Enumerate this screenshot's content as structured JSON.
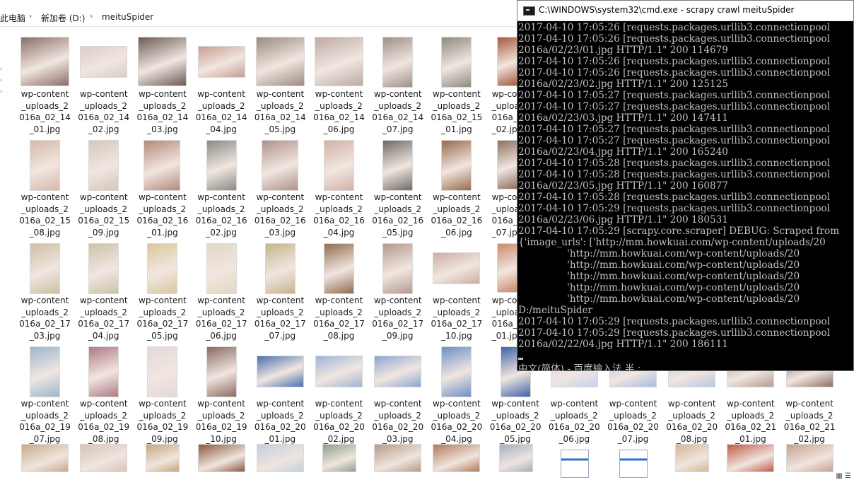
{
  "explorer": {
    "breadcrumb": [
      "此电脑",
      "新加卷 (D:)",
      "meituSpider"
    ],
    "files": [
      {
        "name": [
          "wp-content",
          "_uploads_2",
          "016a_02_14",
          "_01.jpg"
        ],
        "shape": "sq",
        "color": "#8a6f66"
      },
      {
        "name": [
          "wp-content",
          "_uploads_2",
          "016a_02_14",
          "_02.jpg"
        ],
        "shape": "land",
        "color": "#d9ccc7"
      },
      {
        "name": [
          "wp-content",
          "_uploads_2",
          "016a_02_14",
          "_03.jpg"
        ],
        "shape": "sq",
        "color": "#6e5a55"
      },
      {
        "name": [
          "wp-content",
          "_uploads_2",
          "016a_02_14",
          "_04.jpg"
        ],
        "shape": "land",
        "color": "#c79d92"
      },
      {
        "name": [
          "wp-content",
          "_uploads_2",
          "016a_02_14",
          "_05.jpg"
        ],
        "shape": "sq",
        "color": "#9c8a7f"
      },
      {
        "name": [
          "wp-content",
          "_uploads_2",
          "016a_02_14",
          "_06.jpg"
        ],
        "shape": "sq",
        "color": "#bdaaa3"
      },
      {
        "name": [
          "wp-content",
          "_uploads_2",
          "016a_02_14",
          "_07.jpg"
        ],
        "shape": "portn",
        "color": "#a08f88"
      },
      {
        "name": [
          "wp-content",
          "_uploads_2",
          "016a_02_15",
          "_01.jpg"
        ],
        "shape": "portn",
        "color": "#8f8a80"
      },
      {
        "name": [
          "wp-co",
          "_uploa",
          "016a_",
          "_02.jp"
        ],
        "shape": "part",
        "color": "#a35a3a"
      },
      {
        "name": [
          "wp-content",
          "_uploads_2",
          "016a_02_15",
          "_08.jpg"
        ],
        "shape": "portn",
        "color": "#d6b9a8"
      },
      {
        "name": [
          "wp-content",
          "_uploads_2",
          "016a_02_15",
          "_09.jpg"
        ],
        "shape": "portn",
        "color": "#d7c6b9"
      },
      {
        "name": [
          "wp-content",
          "_uploads_2",
          "016a_02_16",
          "_01.jpg"
        ],
        "shape": "port",
        "color": "#b48a79"
      },
      {
        "name": [
          "wp-content",
          "_uploads_2",
          "016a_02_16",
          "_02.jpg"
        ],
        "shape": "portn",
        "color": "#8c8a86"
      },
      {
        "name": [
          "wp-content",
          "_uploads_2",
          "016a_02_16",
          "_03.jpg"
        ],
        "shape": "port",
        "color": "#b0928a"
      },
      {
        "name": [
          "wp-content",
          "_uploads_2",
          "016a_02_16",
          "_04.jpg"
        ],
        "shape": "portn",
        "color": "#d2b2a6"
      },
      {
        "name": [
          "wp-content",
          "_uploads_2",
          "016a_02_16",
          "_05.jpg"
        ],
        "shape": "portn",
        "color": "#6f6a66"
      },
      {
        "name": [
          "wp-content",
          "_uploads_2",
          "016a_02_16",
          "_06.jpg"
        ],
        "shape": "portn",
        "color": "#9a6a4c"
      },
      {
        "name": [
          "wp-co",
          "_uploa",
          "016a_",
          "_07.jp"
        ],
        "shape": "part",
        "color": "#8b7060"
      },
      {
        "name": [
          "wp-content",
          "_uploads_2",
          "016a_02_17",
          "_03.jpg"
        ],
        "shape": "portn",
        "color": "#cdbfa5"
      },
      {
        "name": [
          "wp-content",
          "_uploads_2",
          "016a_02_17",
          "_04.jpg"
        ],
        "shape": "portn",
        "color": "#c9c3a9"
      },
      {
        "name": [
          "wp-content",
          "_uploads_2",
          "016a_02_17",
          "_05.jpg"
        ],
        "shape": "portn",
        "color": "#d9c99e"
      },
      {
        "name": [
          "wp-content",
          "_uploads_2",
          "016a_02_17",
          "_06.jpg"
        ],
        "shape": "portn",
        "color": "#e0d8c2"
      },
      {
        "name": [
          "wp-content",
          "_uploads_2",
          "016a_02_17",
          "_07.jpg"
        ],
        "shape": "portn",
        "color": "#c6b48c"
      },
      {
        "name": [
          "wp-content",
          "_uploads_2",
          "016a_02_17",
          "_08.jpg"
        ],
        "shape": "portn",
        "color": "#8e6e52"
      },
      {
        "name": [
          "wp-content",
          "_uploads_2",
          "016a_02_17",
          "_09.jpg"
        ],
        "shape": "portn",
        "color": "#b39a8c"
      },
      {
        "name": [
          "wp-content",
          "_uploads_2",
          "016a_02_17",
          "_10.jpg"
        ],
        "shape": "land",
        "color": "#c9aea2"
      },
      {
        "name": [
          "wp-co",
          "_uploa",
          "016a_",
          "_01.jp"
        ],
        "shape": "part",
        "color": "#c98a6a"
      },
      {
        "name": [
          "wp-content",
          "_uploads_2",
          "016a_02_19",
          "_07.jpg"
        ],
        "shape": "portn",
        "color": "#9bb7cc"
      },
      {
        "name": [
          "wp-content",
          "_uploads_2",
          "016a_02_19",
          "_08.jpg"
        ],
        "shape": "portn",
        "color": "#b07a86"
      },
      {
        "name": [
          "wp-content",
          "_uploads_2",
          "016a_02_19",
          "_09.jpg"
        ],
        "shape": "portn",
        "color": "#e3d9d8"
      },
      {
        "name": [
          "wp-content",
          "_uploads_2",
          "016a_02_19",
          "_10.jpg"
        ],
        "shape": "portn",
        "color": "#8a6b62"
      },
      {
        "name": [
          "wp-content",
          "_uploads_2",
          "016a_02_20",
          "_01.jpg"
        ],
        "shape": "land",
        "color": "#4a6fae"
      },
      {
        "name": [
          "wp-content",
          "_uploads_2",
          "016a_02_20",
          "_02.jpg"
        ],
        "shape": "land",
        "color": "#9fb4d8"
      },
      {
        "name": [
          "wp-content",
          "_uploads_2",
          "016a_02_20",
          "_03.jpg"
        ],
        "shape": "land",
        "color": "#8ea6d2"
      },
      {
        "name": [
          "wp-content",
          "_uploads_2",
          "016a_02_20",
          "_04.jpg"
        ],
        "shape": "portn",
        "color": "#6f8fc6"
      },
      {
        "name": [
          "wp-content",
          "_uploads_2",
          "016a_02_20",
          "_05.jpg"
        ],
        "shape": "portn",
        "color": "#3f63a8"
      },
      {
        "name": [
          "wp-content",
          "_uploads_2",
          "016a_02_20",
          "_06.jpg"
        ],
        "shape": "land",
        "color": "#c5d3ec"
      },
      {
        "name": [
          "wp-content",
          "_uploads_2",
          "016a_02_20",
          "_07.jpg"
        ],
        "shape": "land",
        "color": "#a9bde2"
      },
      {
        "name": [
          "wp-content",
          "_uploads_2",
          "016a_02_20",
          "_08.jpg"
        ],
        "shape": "land",
        "color": "#b7c7e6"
      },
      {
        "name": [
          "wp-content",
          "_uploads_2",
          "016a_02_21",
          "_01.jpg"
        ],
        "shape": "land",
        "color": "#b39c92"
      },
      {
        "name": [
          "wp-content",
          "_uploads_2",
          "016a_02_21",
          "_02.jpg"
        ],
        "shape": "land",
        "color": "#8e7064"
      }
    ],
    "bottom_row_colors": [
      "#c8a98a",
      "#d8c3b6",
      "#c7a67c",
      "#8a5a3c",
      "#c2d0dc",
      "#8fa08a",
      "#b89a88",
      "#b07a5a",
      "#a5aec0",
      "#ffffff",
      "#ffffff",
      "#d4b892",
      "#c05a48",
      "#c8a090"
    ]
  },
  "cmd": {
    "title": "C:\\WINDOWS\\system32\\cmd.exe - scrapy  crawl meituSpider",
    "lines": [
      "2017-04-10 17:05:26 [requests.packages.urllib3.connectionpool",
      "2017-04-10 17:05:26 [requests.packages.urllib3.connectionpool",
      "2016a/02/23/01.jpg HTTP/1.1\" 200 114679",
      "2017-04-10 17:05:26 [requests.packages.urllib3.connectionpool",
      "2017-04-10 17:05:26 [requests.packages.urllib3.connectionpool",
      "2016a/02/23/02.jpg HTTP/1.1\" 200 125125",
      "2017-04-10 17:05:27 [requests.packages.urllib3.connectionpool",
      "2017-04-10 17:05:27 [requests.packages.urllib3.connectionpool",
      "2016a/02/23/03.jpg HTTP/1.1\" 200 147411",
      "2017-04-10 17:05:27 [requests.packages.urllib3.connectionpool",
      "2017-04-10 17:05:27 [requests.packages.urllib3.connectionpool",
      "2016a/02/23/04.jpg HTTP/1.1\" 200 165240",
      "2017-04-10 17:05:28 [requests.packages.urllib3.connectionpool",
      "2017-04-10 17:05:28 [requests.packages.urllib3.connectionpool",
      "2016a/02/23/05.jpg HTTP/1.1\" 200 160877",
      "2017-04-10 17:05:28 [requests.packages.urllib3.connectionpool",
      "2017-04-10 17:05:29 [requests.packages.urllib3.connectionpool",
      "2016a/02/23/06.jpg HTTP/1.1\" 200 180531",
      "2017-04-10 17:05:29 [scrapy.core.scraper] DEBUG: Scraped from",
      "{'image_urls': ['http://mm.howkuai.com/wp-content/uploads/20",
      "                'http://mm.howkuai.com/wp-content/uploads/20",
      "                'http://mm.howkuai.com/wp-content/uploads/20",
      "                'http://mm.howkuai.com/wp-content/uploads/20",
      "                'http://mm.howkuai.com/wp-content/uploads/20",
      "                'http://mm.howkuai.com/wp-content/uploads/20",
      "D:/meituSpider",
      "2017-04-10 17:05:29 [requests.packages.urllib3.connectionpool",
      "2017-04-10 17:05:29 [requests.packages.urllib3.connectionpool",
      "2016a/02/22/04.jpg HTTP/1.1\" 200 186111"
    ],
    "ime_status": "中文(简体) - 百度输入法 半 :"
  }
}
